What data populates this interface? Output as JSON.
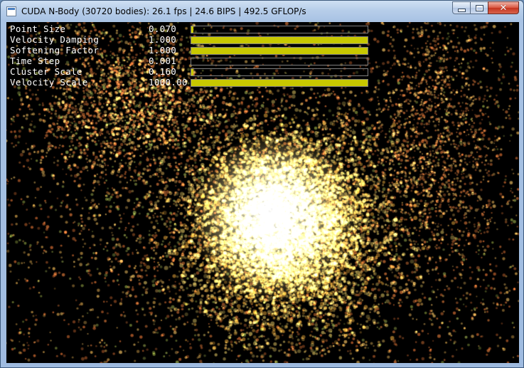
{
  "window": {
    "title": "CUDA N-Body (30720 bodies): 26.1 fps | 24.6 BIPS | 492.5 GFLOP/s",
    "buttons": {
      "minimize": "minimize",
      "maximize": "maximize",
      "close": "✕"
    }
  },
  "parameters": [
    {
      "name": "Point Size",
      "value": "0.070",
      "level": 0.01
    },
    {
      "name": "Velocity Damping",
      "value": "1.000",
      "level": 1.0
    },
    {
      "name": "Softening Factor",
      "value": "1.000",
      "level": 1.0
    },
    {
      "name": "Time Step",
      "value": "0.001",
      "level": 0.0
    },
    {
      "name": "Cluster Scale",
      "value": "0.160",
      "level": 0.016
    },
    {
      "name": "Velocity Scale",
      "value": "1000.00",
      "level": 1.0
    }
  ],
  "colors": {
    "slider_fill": "#c8c800",
    "particle_core": "#ffffff",
    "particle_glow": "#ffe680",
    "particle_outer": "#e07a3a"
  }
}
